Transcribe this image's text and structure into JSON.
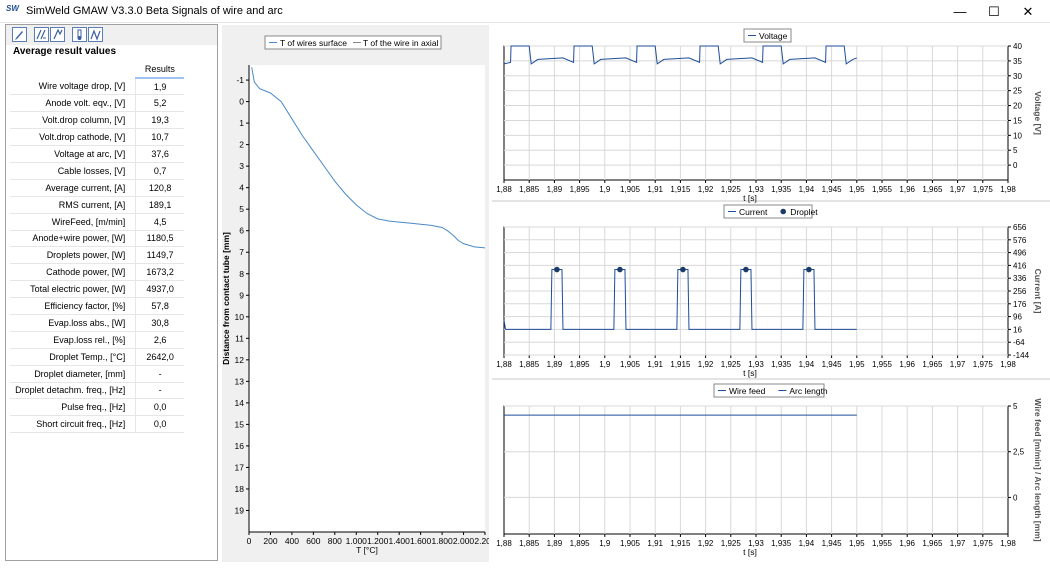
{
  "window": {
    "title": "SimWeld GMAW V3.3.0 Beta Signals of wire and arc",
    "app_icon": "SW",
    "minimize": "—",
    "maximize": "☐",
    "close": "✕"
  },
  "left": {
    "title": "Average result values",
    "column_header": "Results",
    "rows": [
      {
        "label": "Wire voltage drop, [V]",
        "value": "1,9"
      },
      {
        "label": "Anode volt. eqv., [V]",
        "value": "5,2"
      },
      {
        "label": "Volt.drop column, [V]",
        "value": "19,3"
      },
      {
        "label": "Volt.drop cathode, [V]",
        "value": "10,7"
      },
      {
        "label": "Voltage at arc, [V]",
        "value": "37,6"
      },
      {
        "label": "Cable losses, [V]",
        "value": "0,7"
      },
      {
        "label": "Average current, [A]",
        "value": "120,8"
      },
      {
        "label": "RMS current, [A]",
        "value": "189,1"
      },
      {
        "label": "WireFeed, [m/min]",
        "value": "4,5"
      },
      {
        "label": "Anode+wire power, [W]",
        "value": "1180,5"
      },
      {
        "label": "Droplets power, [W]",
        "value": "1149,7"
      },
      {
        "label": "Cathode power, [W]",
        "value": "1673,2"
      },
      {
        "label": "Total electric power, [W]",
        "value": "4937,0"
      },
      {
        "label": "Efficiency factor, [%]",
        "value": "57,8"
      },
      {
        "label": "Evap.loss abs., [W]",
        "value": "30,8"
      },
      {
        "label": "Evap.loss rel., [%]",
        "value": "2,6"
      },
      {
        "label": "Droplet Temp., [°C]",
        "value": "2642,0"
      },
      {
        "label": "Droplet diameter, [mm]",
        "value": "-"
      },
      {
        "label": "Droplet detachm. freq., [Hz]",
        "value": "-"
      },
      {
        "label": "Pulse freq., [Hz]",
        "value": "0,0"
      },
      {
        "label": "Short circuit freq., [Hz]",
        "value": "0,0"
      }
    ]
  },
  "chart_data": [
    {
      "type": "line",
      "legend": [
        "T of wires surface",
        "T of the wire in axial"
      ],
      "legend_position": "top",
      "xlabel": "T [°C]",
      "ylabel": "Distance from contact tube [mm]",
      "x_ticks": [
        "0",
        "200",
        "400",
        "600",
        "800",
        "1.000",
        "1.200",
        "1.400",
        "1.600",
        "1.800",
        "2.000",
        "2.200"
      ],
      "y_ticks": [
        "-1",
        "0",
        "1",
        "2",
        "3",
        "4",
        "5",
        "6",
        "7",
        "8",
        "9",
        "10",
        "11",
        "12",
        "13",
        "14",
        "15",
        "16",
        "17",
        "18",
        "19"
      ],
      "xlim": [
        0,
        2200
      ],
      "ylim": [
        -1.7,
        20
      ],
      "y_inverted": true,
      "grid": false,
      "series": [
        {
          "name": "T of wires surface",
          "color": "#4a8ac8",
          "x": [
            25,
            50,
            100,
            200,
            300,
            400,
            500,
            600,
            700,
            800,
            900,
            1000,
            1100,
            1200,
            1300,
            1400,
            1500,
            1600,
            1700,
            1800,
            1850,
            1900,
            1950,
            2000,
            2100,
            2200
          ],
          "y": [
            -1.6,
            -0.9,
            -0.6,
            -0.4,
            0.0,
            0.8,
            1.6,
            2.3,
            3.0,
            3.7,
            4.3,
            4.8,
            5.2,
            5.45,
            5.55,
            5.6,
            5.65,
            5.7,
            5.75,
            5.85,
            6.0,
            6.2,
            6.45,
            6.6,
            6.75,
            6.8
          ]
        }
      ]
    },
    {
      "type": "line",
      "legend": [
        "Voltage"
      ],
      "legend_position": "top",
      "xlabel": "t [s]",
      "ylabel": "Voltage [V]",
      "x_ticks": [
        "1,88",
        "1,885",
        "1,89",
        "1,895",
        "1,9",
        "1,905",
        "1,91",
        "1,915",
        "1,92",
        "1,925",
        "1,93",
        "1,935",
        "1,94",
        "1,945",
        "1,95",
        "1,955",
        "1,96",
        "1,965",
        "1,97",
        "1,975",
        "1,98"
      ],
      "y_ticks": [
        "0",
        "5",
        "10",
        "15",
        "20",
        "25",
        "30",
        "35",
        "40"
      ],
      "xlim": [
        1.88,
        1.98
      ],
      "ylim": [
        -5,
        40
      ],
      "grid": true,
      "series": [
        {
          "name": "Voltage",
          "color": "#1f4e9a",
          "x_start": 1.88,
          "x_end": 1.95,
          "base": 36,
          "peak": 40,
          "pulse_period": 0.0125
        }
      ]
    },
    {
      "type": "line",
      "legend": [
        "Current",
        "Droplet"
      ],
      "legend_position": "top",
      "xlabel": "t [s]",
      "ylabel": "Current [A]",
      "x_ticks": [
        "1,88",
        "1,885",
        "1,89",
        "1,895",
        "1,9",
        "1,905",
        "1,91",
        "1,915",
        "1,92",
        "1,925",
        "1,93",
        "1,935",
        "1,94",
        "1,945",
        "1,95",
        "1,955",
        "1,96",
        "1,965",
        "1,97",
        "1,975",
        "1,98"
      ],
      "y_ticks": [
        "-144",
        "-64",
        "16",
        "96",
        "176",
        "256",
        "336",
        "416",
        "496",
        "576",
        "656"
      ],
      "xlim": [
        1.88,
        1.98
      ],
      "ylim": [
        -144,
        656
      ],
      "grid": true,
      "series": [
        {
          "name": "Current",
          "color": "#1f4e9a",
          "base": 16,
          "peak": 390,
          "pulses": [
            [
              1.8895,
              1.8915
            ],
            [
              1.902,
              1.904
            ],
            [
              1.9145,
              1.9165
            ],
            [
              1.927,
              1.929
            ],
            [
              1.9395,
              1.9415
            ]
          ],
          "x_end": 1.95
        },
        {
          "name": "Droplet",
          "color": "#1a3a6a",
          "x": [
            1.8905,
            1.903,
            1.9155,
            1.928,
            1.9405
          ],
          "y": [
            390,
            390,
            390,
            390,
            390
          ]
        }
      ]
    },
    {
      "type": "line",
      "legend": [
        "Wire feed",
        "Arc length"
      ],
      "legend_position": "top",
      "xlabel": "t [s]",
      "ylabel": "Wire feed [m/min] / Arc length [mm]",
      "x_ticks": [
        "1,88",
        "1,885",
        "1,89",
        "1,895",
        "1,9",
        "1,905",
        "1,91",
        "1,915",
        "1,92",
        "1,925",
        "1,93",
        "1,935",
        "1,94",
        "1,945",
        "1,95",
        "1,955",
        "1,96",
        "1,965",
        "1,97",
        "1,975",
        "1,98"
      ],
      "y_ticks": [
        "0",
        "2,5",
        "5"
      ],
      "xlim": [
        1.88,
        1.98
      ],
      "ylim": [
        -2,
        5
      ],
      "grid": true,
      "series": [
        {
          "name": "Wire feed",
          "color": "#1f4e9a",
          "x": [
            1.88,
            1.95
          ],
          "y": [
            4.5,
            4.5
          ]
        }
      ]
    }
  ]
}
